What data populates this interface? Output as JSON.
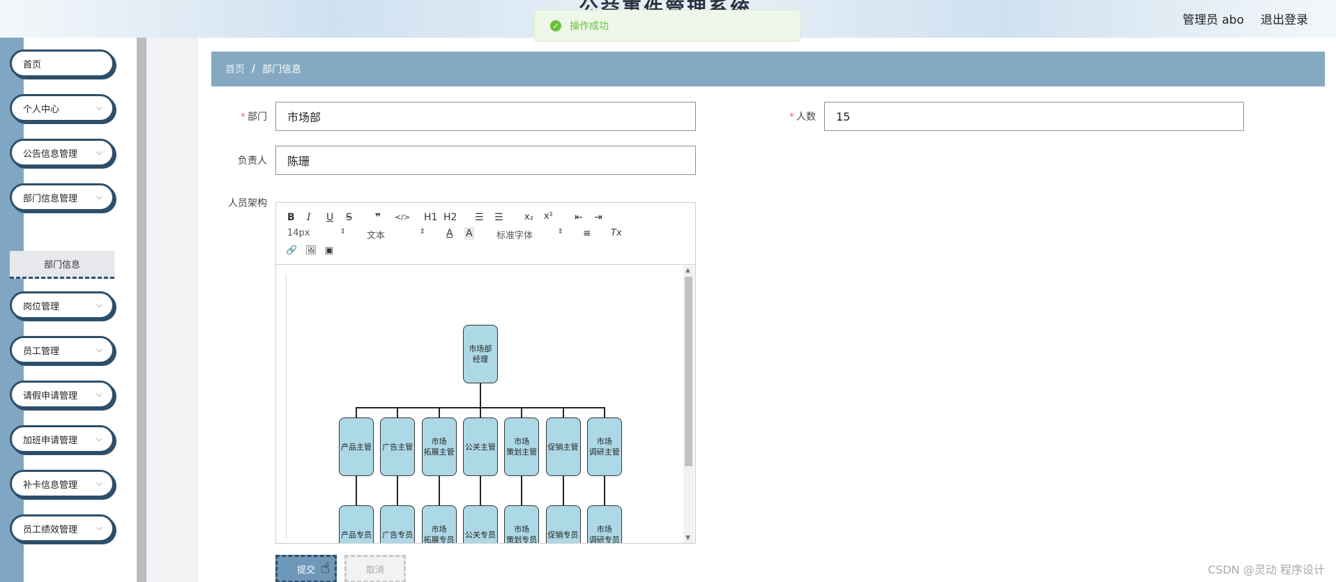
{
  "header": {
    "title": "公益事件管理系统",
    "user": "管理员 abo",
    "logout": "退出登录"
  },
  "toast": {
    "message": "操作成功"
  },
  "sidebar": {
    "items": [
      {
        "label": "首页",
        "has_children": false
      },
      {
        "label": "个人中心",
        "has_children": true
      },
      {
        "label": "公告信息管理",
        "has_children": true
      },
      {
        "label": "部门信息管理",
        "has_children": true
      },
      {
        "label": "岗位管理",
        "has_children": true
      },
      {
        "label": "员工管理",
        "has_children": true
      },
      {
        "label": "请假申请管理",
        "has_children": true
      },
      {
        "label": "加班申请管理",
        "has_children": true
      },
      {
        "label": "补卡信息管理",
        "has_children": true
      },
      {
        "label": "员工绩效管理",
        "has_children": true
      }
    ],
    "active_sub": "部门信息"
  },
  "breadcrumb": {
    "home": "首页",
    "separator": "/",
    "current": "部门信息"
  },
  "form": {
    "department": {
      "label": "部门",
      "value": "市场部",
      "required": true
    },
    "headcount": {
      "label": "人数",
      "value": "15",
      "required": true
    },
    "leader": {
      "label": "负责人",
      "value": "陈珊"
    },
    "structure": {
      "label": "人员架构"
    }
  },
  "editor": {
    "toolbar": {
      "bold": "B",
      "italic": "I",
      "underline": "U",
      "strike": "S",
      "quote": "❞",
      "code": "</>",
      "h1": "H1",
      "h2": "H2",
      "ordered": "☰",
      "bullet": "☰",
      "sub": "x₂",
      "sup": "x²",
      "outdent": "⇤",
      "indent": "⇥",
      "size": "14px",
      "format": "文本",
      "font": "标准字体",
      "color": "A",
      "background": "A",
      "align": "≡",
      "clear": "Tx",
      "link": "🔗",
      "image": "🖼",
      "video": "▣"
    },
    "org_chart": {
      "root": "市场部\n经理",
      "managers": [
        "产品主管",
        "广告主管",
        "市场\n拓展主管",
        "公关主管",
        "市场\n策划主管",
        "促销主管",
        "市场\n调研主管"
      ],
      "staff": [
        "产品专员",
        "广告专员",
        "市场\n拓展专员",
        "公关专员",
        "市场\n策划专员",
        "促销专员",
        "市场\n调研专员"
      ]
    }
  },
  "buttons": {
    "submit": "提交",
    "cancel": "取消"
  },
  "watermark": "CSDN @灵动 程序设计"
}
